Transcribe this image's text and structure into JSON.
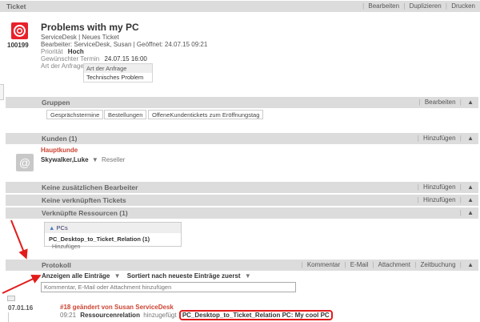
{
  "ticket": {
    "header_title": "Ticket",
    "actions": [
      "Bearbeiten",
      "Duplizieren",
      "Drucken"
    ],
    "number": "100199",
    "title": "Problems with my PC",
    "queue_line": "ServiceDesk | Neues Ticket",
    "editor_line": "Bearbeiter: ServiceDesk, Susan | Geöffnet: 24.07.15 09:21",
    "priority_label": "Priorität",
    "priority_value": "Hoch",
    "deadline_label": "Gewünschter Termin",
    "deadline_value": "24.07.15 16:00",
    "request_type_label": "Art der Anfrage",
    "request_type_header": "Art der Anfrage",
    "request_type_value": "Technisches Problem"
  },
  "groups": {
    "title": "Gruppen",
    "action": "Bearbeiten",
    "tags": [
      "Gesprächstermine",
      "Bestellungen",
      "OffeneKundentickets zum Eröffnungstag"
    ]
  },
  "customers": {
    "title": "Kunden (1)",
    "action": "Hinzufügen",
    "main_label": "Hauptkunde",
    "customer_name": "Skywalker,Luke",
    "customer_role": "Reseller"
  },
  "extra_editors": {
    "title": "Keine zusätzlichen Bearbeiter",
    "action": "Hinzufügen"
  },
  "linked_tickets": {
    "title": "Keine verknüpften Tickets",
    "action": "Hinzufügen"
  },
  "resources": {
    "title": "Verknüpfte Ressourcen (1)",
    "group_label": "PCs",
    "item_name": "PC_Desktop_to_Ticket_Relation (1)",
    "item_action": "Hinzufügen"
  },
  "protocol": {
    "title": "Protokoll",
    "actions": [
      "Kommentar",
      "E-Mail",
      "Attachment",
      "Zeitbuchung"
    ],
    "filter_label": "Anzeigen alle Einträge",
    "sort_label": "Sortiert nach neueste Einträge zuerst",
    "comment_placeholder": "Kommentar, E-Mail oder Attachment hinzufügen",
    "entry_date": "07.01.16",
    "entry_title": "#18 geändert von Susan ServiceDesk",
    "entry_time": "09:21",
    "entry_field": "Ressourcenrelation",
    "entry_verb": "hinzugefügt",
    "entry_value": "PC_Desktop_to_Ticket_Relation PC: My cool PC"
  },
  "colors": {
    "accent_red": "#e8212b",
    "bar_grey": "#dcdcdc",
    "label_red": "#cc3333"
  }
}
